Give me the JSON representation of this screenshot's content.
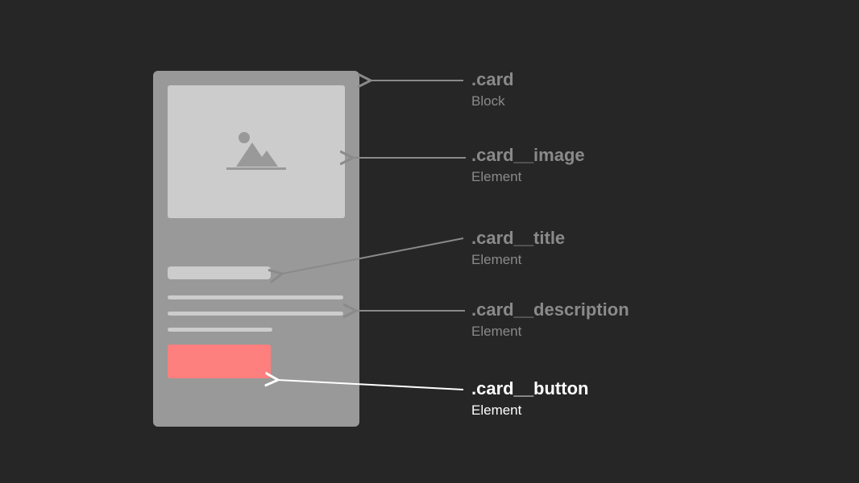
{
  "annotations": {
    "card": {
      "class_name": ".card",
      "type": "Block",
      "highlighted": false
    },
    "image": {
      "class_name": ".card__image",
      "type": "Element",
      "highlighted": false
    },
    "title": {
      "class_name": ".card__title",
      "type": "Element",
      "highlighted": false
    },
    "desc": {
      "class_name": ".card__description",
      "type": "Element",
      "highlighted": false
    },
    "button": {
      "class_name": ".card__button",
      "type": "Element",
      "highlighted": true
    }
  }
}
